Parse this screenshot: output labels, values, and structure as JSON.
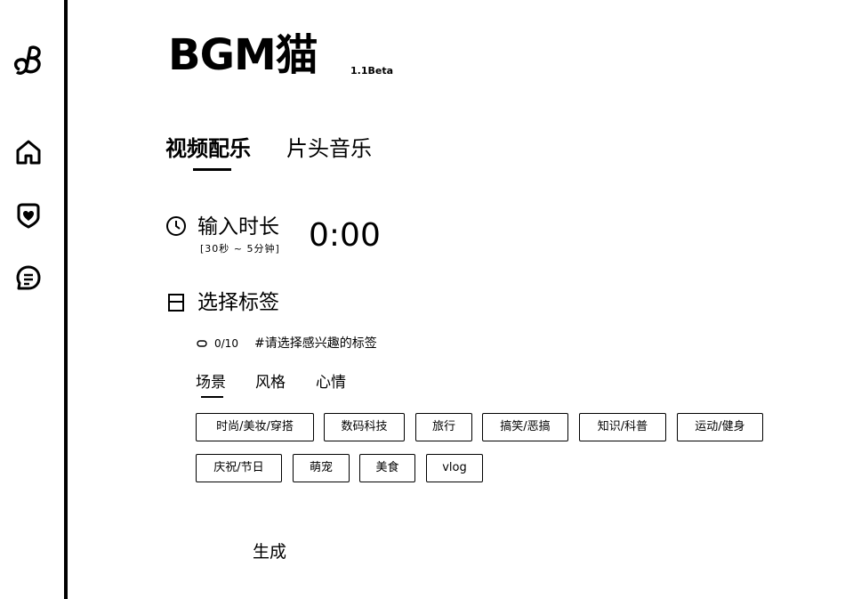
{
  "app": {
    "logo_text": "BGM猫",
    "version": "1.1Beta"
  },
  "sidebar": {
    "items": [
      {
        "icon": "app-logo-icon"
      },
      {
        "icon": "home-icon"
      },
      {
        "icon": "heart-icon"
      },
      {
        "icon": "chat-icon"
      }
    ]
  },
  "tabs": [
    {
      "label": "视频配乐",
      "active": true
    },
    {
      "label": "片头音乐",
      "active": false
    }
  ],
  "duration": {
    "title": "输入时长",
    "hint": "[30秒 ~ 5分钟]",
    "value": "0:00"
  },
  "tags": {
    "title": "选择标签",
    "counter": "0/10",
    "hint": "#请选择感兴趣的标签",
    "categories": [
      {
        "label": "场景",
        "active": true
      },
      {
        "label": "风格",
        "active": false
      },
      {
        "label": "心情",
        "active": false
      }
    ],
    "items": [
      "时尚/美妆/穿搭",
      "数码科技",
      "旅行",
      "搞笑/恶搞",
      "知识/科普",
      "运动/健身",
      "庆祝/节日",
      "萌宠",
      "美食",
      "vlog"
    ]
  },
  "generate_label": "生成"
}
